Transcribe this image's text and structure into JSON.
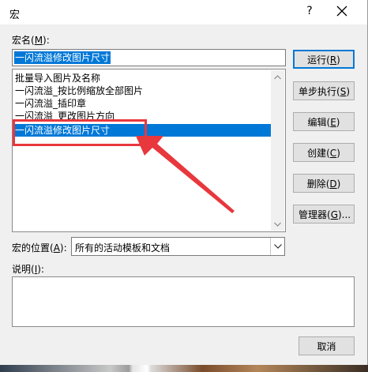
{
  "window": {
    "title": "宏",
    "help_label": "?"
  },
  "macro_name": {
    "label_text": "宏名(",
    "label_key": "M",
    "label_tail": "):",
    "value": "一闪流溢修改图片尺寸"
  },
  "macro_list": {
    "items": [
      "批量导入图片及名称",
      "一闪流溢_按比例缩放全部图片",
      "一闪流溢_插印章",
      "一闪流溢_更改图片方向",
      "一闪流溢修改图片尺寸"
    ],
    "selected_index": 4
  },
  "buttons": {
    "run": {
      "text": "运行(",
      "key": "R",
      "tail": ")"
    },
    "step": {
      "text": "单步执行(",
      "key": "S",
      "tail": ")"
    },
    "edit": {
      "text": "编辑(",
      "key": "E",
      "tail": ")"
    },
    "create": {
      "text": "创建(",
      "key": "C",
      "tail": ")"
    },
    "delete": {
      "text": "删除(",
      "key": "D",
      "tail": ")"
    },
    "organizer": {
      "text": "管理器(",
      "key": "G",
      "tail": ")..."
    },
    "cancel": {
      "text": "取消"
    }
  },
  "location": {
    "label_text": "宏的位置(",
    "label_key": "A",
    "label_tail": "):",
    "value": "所有的活动模板和文档"
  },
  "description": {
    "label_text": "说明(",
    "label_key": "I",
    "label_tail": "):",
    "value": ""
  },
  "colors": {
    "selection": "#0078d7",
    "annotation": "#e8373d"
  }
}
